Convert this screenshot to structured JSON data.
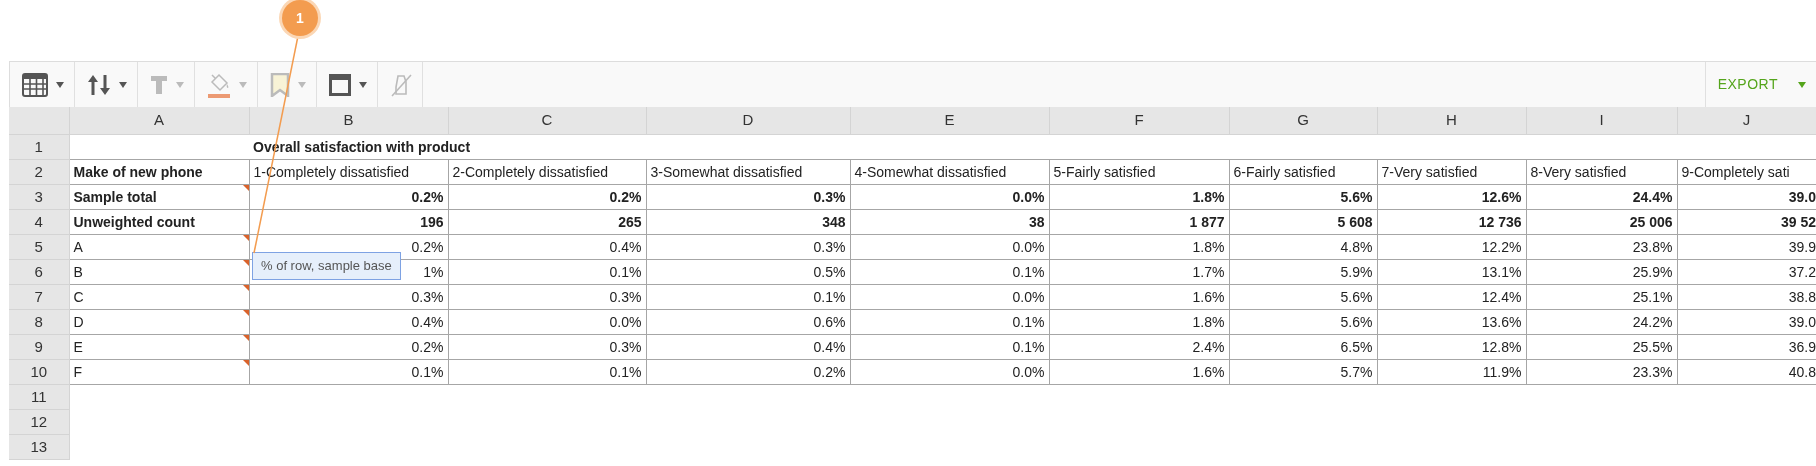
{
  "annotation": {
    "number": "1"
  },
  "toolbar": [
    {
      "kind": "table",
      "disabled": false,
      "caret": true
    },
    {
      "kind": "sort",
      "disabled": false,
      "caret": true
    },
    {
      "kind": "text",
      "disabled": true,
      "caret": true
    },
    {
      "kind": "fill",
      "disabled": true,
      "caret": true
    },
    {
      "kind": "bookmark",
      "disabled": true,
      "caret": true
    },
    {
      "kind": "frame",
      "disabled": false,
      "caret": true
    },
    {
      "kind": "clear",
      "disabled": true,
      "caret": false
    }
  ],
  "export": {
    "label": "EXPORT"
  },
  "columns": [
    "A",
    "B",
    "C",
    "D",
    "E",
    "F",
    "G",
    "H",
    "I",
    "J"
  ],
  "rows": [
    {
      "number": "1",
      "kind": "title",
      "title": "Overall satisfaction with product"
    },
    {
      "number": "2",
      "kind": "header",
      "label": "Make of new phone",
      "comment": false,
      "values": [
        "1-Completely dissatisfied",
        "2-Completely dissatisfied",
        "3-Somewhat dissatisfied",
        "4-Somewhat dissatisfied",
        "5-Fairly satisfied",
        "6-Fairly satisfied",
        "7-Very satisfied",
        "8-Very satisfied",
        "9-Completely sati"
      ]
    },
    {
      "number": "3",
      "kind": "total",
      "label": "Sample total",
      "comment": true,
      "values": [
        "0.2%",
        "0.2%",
        "0.3%",
        "0.0%",
        "1.8%",
        "5.6%",
        "12.6%",
        "24.4%",
        "39.0"
      ]
    },
    {
      "number": "4",
      "kind": "total",
      "label": "Unweighted count",
      "comment": false,
      "values": [
        "196",
        "265",
        "348",
        "38",
        "1 877",
        "5 608",
        "12 736",
        "25 006",
        "39 52"
      ]
    },
    {
      "number": "5",
      "kind": "data",
      "label": "A",
      "comment": true,
      "values": [
        "0.2%",
        "0.4%",
        "0.3%",
        "0.0%",
        "1.8%",
        "4.8%",
        "12.2%",
        "23.8%",
        "39.9"
      ]
    },
    {
      "number": "6",
      "kind": "data",
      "label": "B",
      "comment": true,
      "values": [
        "1%",
        "0.1%",
        "0.5%",
        "0.1%",
        "1.7%",
        "5.9%",
        "13.1%",
        "25.9%",
        "37.2"
      ]
    },
    {
      "number": "7",
      "kind": "data",
      "label": "C",
      "comment": true,
      "values": [
        "0.3%",
        "0.3%",
        "0.1%",
        "0.0%",
        "1.6%",
        "5.6%",
        "12.4%",
        "25.1%",
        "38.8"
      ]
    },
    {
      "number": "8",
      "kind": "data",
      "label": "D",
      "comment": true,
      "values": [
        "0.4%",
        "0.0%",
        "0.6%",
        "0.1%",
        "1.8%",
        "5.6%",
        "13.6%",
        "24.2%",
        "39.0"
      ]
    },
    {
      "number": "9",
      "kind": "data",
      "label": "E",
      "comment": true,
      "values": [
        "0.2%",
        "0.3%",
        "0.4%",
        "0.1%",
        "2.4%",
        "6.5%",
        "12.8%",
        "25.5%",
        "36.9"
      ]
    },
    {
      "number": "10",
      "kind": "data",
      "label": "F",
      "comment": true,
      "values": [
        "0.1%",
        "0.1%",
        "0.2%",
        "0.0%",
        "1.6%",
        "5.7%",
        "11.9%",
        "23.3%",
        "40.8"
      ]
    },
    {
      "number": "11",
      "kind": "empty"
    },
    {
      "number": "12",
      "kind": "empty"
    },
    {
      "number": "13",
      "kind": "empty"
    }
  ],
  "tooltip": {
    "text": "% of row, sample base"
  }
}
